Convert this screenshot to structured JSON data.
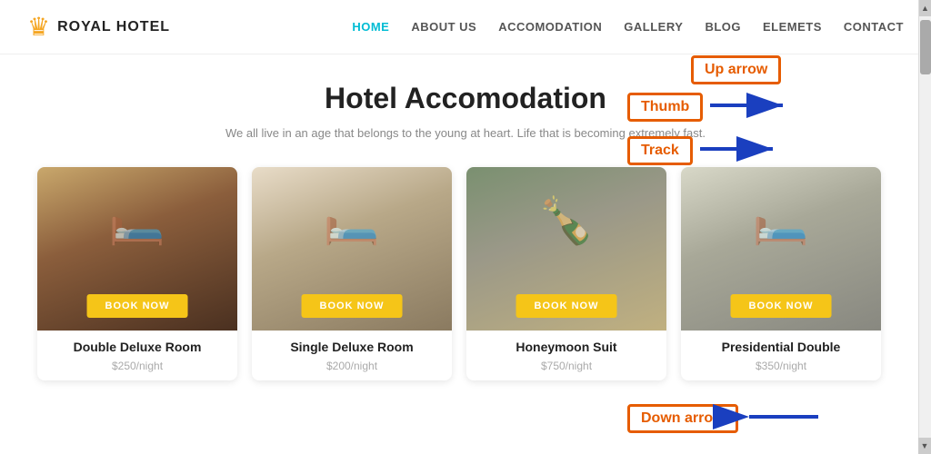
{
  "header": {
    "logo_icon": "♛",
    "logo_text": "ROYAL HOTEL",
    "nav": [
      {
        "id": "home",
        "label": "HOME",
        "active": true
      },
      {
        "id": "about",
        "label": "ABOUT US",
        "active": false
      },
      {
        "id": "accomodation",
        "label": "ACCOMODATION",
        "active": false
      },
      {
        "id": "gallery",
        "label": "GALLERY",
        "active": false
      },
      {
        "id": "blog",
        "label": "BLOG",
        "active": false
      },
      {
        "id": "elements",
        "label": "ELEMETS",
        "active": false
      },
      {
        "id": "contact",
        "label": "CONTACT",
        "active": false
      }
    ]
  },
  "main": {
    "section_title": "Hotel Accomodation",
    "section_subtitle": "We all live in an age that belongs to the young at heart. Life that is becoming extremely fast.",
    "cards": [
      {
        "id": "double-deluxe",
        "name": "Double Deluxe Room",
        "price": "$250",
        "unit": "/night",
        "btn_label": "BOOK NOW",
        "img_type": "room-double"
      },
      {
        "id": "single-deluxe",
        "name": "Single Deluxe Room",
        "price": "$200",
        "unit": "/night",
        "btn_label": "BOOK NOW",
        "img_type": "room-single"
      },
      {
        "id": "honeymoon",
        "name": "Honeymoon Suit",
        "price": "$750",
        "unit": "/night",
        "btn_label": "BOOK NOW",
        "img_type": "room-honeymoon"
      },
      {
        "id": "presidential",
        "name": "Presidential Double",
        "price": "$350",
        "unit": "/night",
        "btn_label": "BOOK NOW",
        "img_type": "room-presidential"
      }
    ]
  },
  "annotations": {
    "up_arrow": "Up arrow",
    "thumb": "Thumb",
    "track": "Track",
    "down_arrow": "Down arrow"
  },
  "scrollbar": {
    "up_arrow": "▲",
    "down_arrow": "▼"
  }
}
